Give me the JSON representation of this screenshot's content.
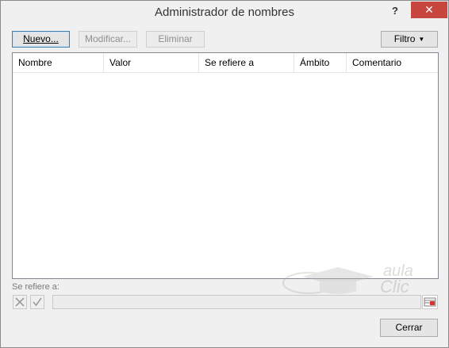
{
  "window": {
    "title": "Administrador de nombres",
    "help_label": "?",
    "close_label": "✕",
    "accent_close": "#c7463d"
  },
  "toolbar": {
    "new_label": "Nuevo...",
    "modify_label": "Modificar...",
    "delete_label": "Eliminar",
    "filter_label": "Filtro"
  },
  "table": {
    "columns": [
      "Nombre",
      "Valor",
      "Se refiere a",
      "Ámbito",
      "Comentario"
    ],
    "rows": []
  },
  "refers_to": {
    "label": "Se refiere a:",
    "value": ""
  },
  "footer": {
    "close_label": "Cerrar"
  },
  "watermark": {
    "line1": "aula",
    "line2": "Clic"
  },
  "icons": {
    "cancel": "x-icon",
    "accept": "check-icon",
    "collapse": "range-collapse-icon",
    "filter_caret": "caret-down-icon"
  }
}
